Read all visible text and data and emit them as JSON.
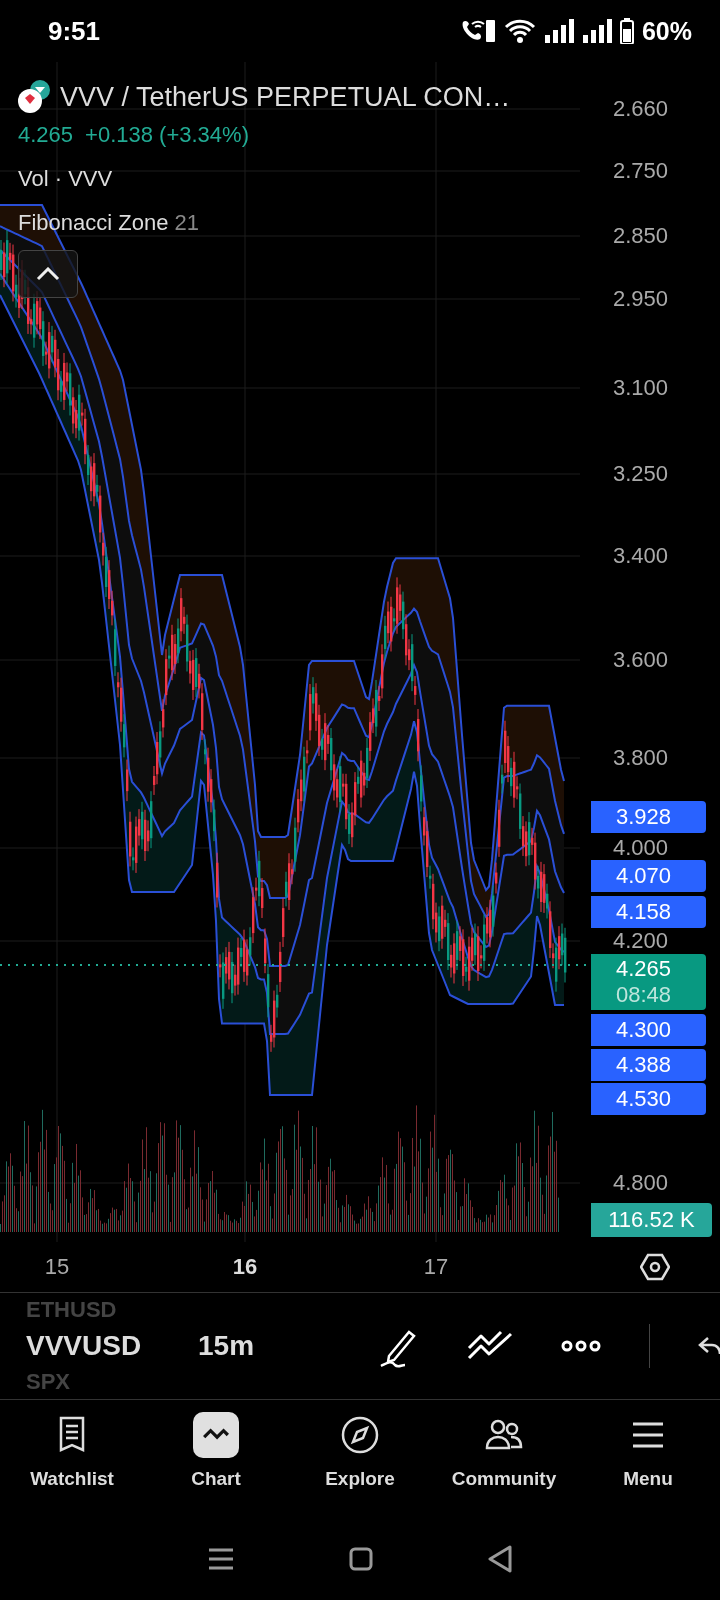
{
  "status_bar": {
    "time": "9:51",
    "battery": "60%"
  },
  "chart": {
    "title": "VVV / TetherUS PERPETUAL CON…",
    "price": "4.265",
    "change": "+0.138 (+3.34%)",
    "indicators": [
      {
        "name": "Vol · VVV"
      },
      {
        "name": "Fibonacci Zone",
        "param": "21"
      }
    ],
    "price_axis": [
      "2.660",
      "2.750",
      "2.850",
      "2.950",
      "3.100",
      "3.250",
      "3.400",
      "3.600",
      "3.800",
      "4.000",
      "4.200",
      "4.800"
    ],
    "price_badges": [
      {
        "kind": "level",
        "text": "3.928"
      },
      {
        "kind": "level",
        "text": "4.070"
      },
      {
        "kind": "level",
        "text": "4.158"
      },
      {
        "kind": "last",
        "text": "4.265",
        "sub": "08:48"
      },
      {
        "kind": "level",
        "text": "4.300"
      },
      {
        "kind": "level",
        "text": "4.388"
      },
      {
        "kind": "level",
        "text": "4.530"
      },
      {
        "kind": "volume",
        "text": "116.52 K"
      }
    ],
    "time_axis": [
      {
        "label": "15",
        "emphasized": false
      },
      {
        "label": "16",
        "emphasized": true
      },
      {
        "label": "17",
        "emphasized": false
      }
    ]
  },
  "toolbar": {
    "symbols": [
      {
        "label": "ETHUSD",
        "selected": false
      },
      {
        "label": "VVVUSD",
        "selected": true
      },
      {
        "label": "SPX",
        "selected": false
      }
    ],
    "interval": "15m"
  },
  "nav": [
    {
      "label": "Watchlist",
      "selected": false
    },
    {
      "label": "Chart",
      "selected": true
    },
    {
      "label": "Explore",
      "selected": false
    },
    {
      "label": "Community",
      "selected": false
    },
    {
      "label": "Menu",
      "selected": false
    }
  ]
}
